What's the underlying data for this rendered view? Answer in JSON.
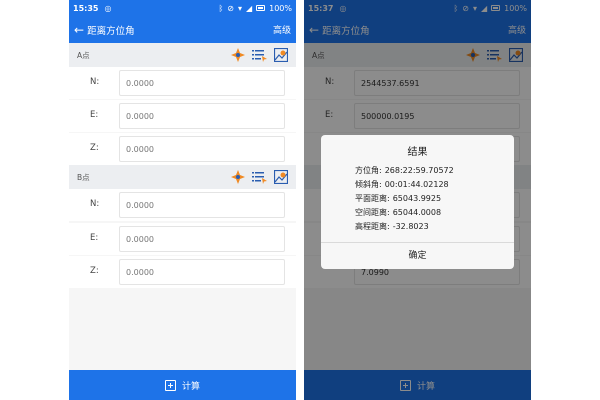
{
  "left": {
    "status": {
      "time": "15:35",
      "battery": "100%"
    },
    "title": "距离方位角",
    "advanced": "高级",
    "pointA": {
      "label": "A点",
      "fields": [
        {
          "label": "N:",
          "value": "0.0000"
        },
        {
          "label": "E:",
          "value": "0.0000"
        },
        {
          "label": "Z:",
          "value": "0.0000"
        }
      ]
    },
    "pointB": {
      "label": "B点",
      "fields": [
        {
          "label": "N:",
          "value": "0.0000"
        },
        {
          "label": "E:",
          "value": "0.0000"
        },
        {
          "label": "Z:",
          "value": "0.0000"
        }
      ]
    },
    "calc_label": "计算"
  },
  "right": {
    "status": {
      "time": "15:37",
      "battery": "100%"
    },
    "title": "距离方位角",
    "advanced": "高级",
    "pointA": {
      "label": "A点",
      "fields": [
        {
          "label": "N:",
          "value": "2544537.6591"
        },
        {
          "label": "E:",
          "value": "500000.0195"
        }
      ]
    },
    "partial_value": "7.0990",
    "calc_label": "计算",
    "dialog": {
      "title": "结果",
      "lines": [
        {
          "key": "方位角:",
          "value": "268:22:59.70572"
        },
        {
          "key": "倾斜角:",
          "value": "00:01:44.02128"
        },
        {
          "key": "平面距离:",
          "value": "65043.9925"
        },
        {
          "key": "空间距离:",
          "value": "65044.0008"
        },
        {
          "key": "高程距离:",
          "value": "-32.8023"
        }
      ],
      "ok": "确定"
    }
  },
  "colors": {
    "primary": "#1e73e8",
    "icon_orange": "#f08a24",
    "icon_blue": "#2a5db0"
  },
  "icons": [
    "compass-point-icon",
    "point-list-icon",
    "map-pick-icon",
    "calculator-icon"
  ]
}
